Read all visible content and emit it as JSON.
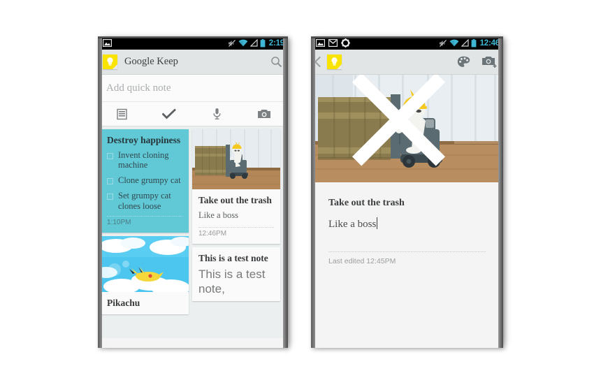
{
  "phone1": {
    "status_bar": {
      "left_icons": [
        "image-icon"
      ],
      "right_icons": [
        "mute-icon",
        "wifi-icon",
        "signal-icon",
        "battery-icon"
      ],
      "time": "2:19"
    },
    "action_bar": {
      "logo": "keep-logo-icon",
      "title": "Google Keep",
      "search_icon": "search-icon"
    },
    "quick_note": {
      "placeholder": "Add quick note",
      "tools": [
        "list-icon",
        "checkmark-icon",
        "microphone-icon",
        "camera-icon"
      ]
    },
    "notes": [
      {
        "id": "destroy-happiness",
        "title": "Destroy happiness",
        "color": "#61c8d6",
        "checklist": [
          "Invent cloning machine",
          "Clone grumpy cat",
          "Set grumpy cat clones loose"
        ],
        "timestamp": "1:10PM"
      },
      {
        "id": "take-out-the-trash",
        "title": "Take out the trash",
        "body": "Like a boss",
        "timestamp": "12:46PM",
        "image": "forklift-toy-photo"
      },
      {
        "id": "pikachu-note",
        "title": "Pikachu",
        "image": "pikachu-cloud-photo"
      },
      {
        "id": "this-is-a-test-note",
        "title": "This is a test note",
        "body": "This is a test note,"
      }
    ]
  },
  "phone2": {
    "status_bar": {
      "left_icons": [
        "image-icon",
        "gmail-icon",
        "gear-icon"
      ],
      "right_icons": [
        "mute-icon",
        "wifi-icon",
        "signal-icon",
        "battery-icon"
      ],
      "time": "12:46"
    },
    "action_bar": {
      "back_icon": "back-chevron-icon",
      "logo": "keep-logo-icon",
      "palette_icon": "palette-icon",
      "camera_add_icon": "camera-add-icon"
    },
    "note": {
      "image": "forklift-toy-photo",
      "close_icon": "close-icon",
      "title": "Take out the trash",
      "body": "Like a boss",
      "last_edited": "Last edited 12:45PM"
    }
  },
  "colors": {
    "teal_note": "#61c8d6",
    "keep_yellow": "#f9e300",
    "status_time": "#3fb7d4",
    "action_bar": "#e2e5e6"
  }
}
